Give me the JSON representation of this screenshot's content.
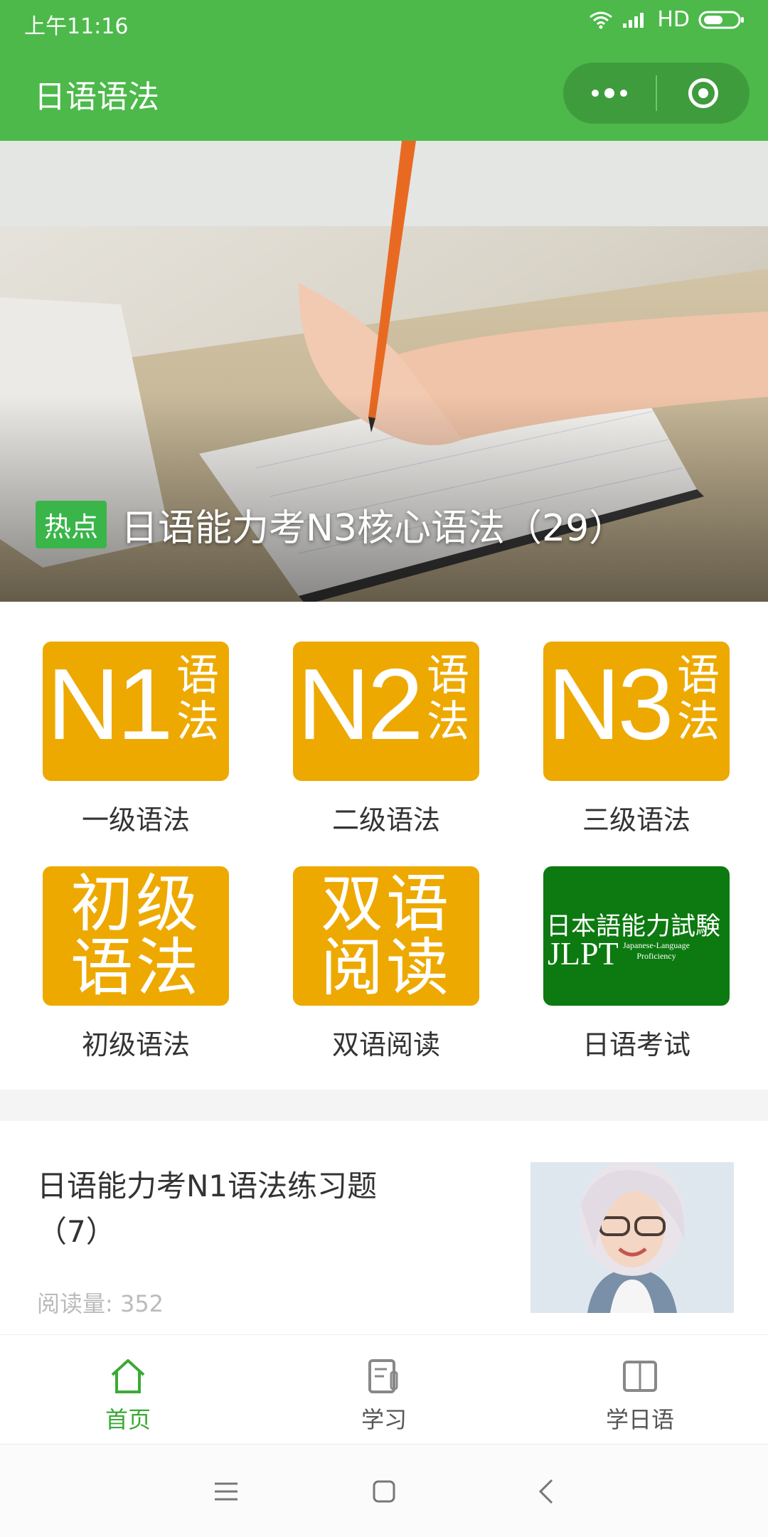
{
  "status": {
    "time": "上午11:16",
    "network": "HD"
  },
  "header": {
    "title": "日语语法",
    "more_icon": "more-dots-icon",
    "close_icon": "target-icon"
  },
  "banner": {
    "badge": "热点",
    "title": "日语能力考N3核心语法（29）"
  },
  "tiles": [
    {
      "big": "N1",
      "small1": "语",
      "small2": "法",
      "label": "一级语法"
    },
    {
      "big": "N2",
      "small1": "语",
      "small2": "法",
      "label": "二级语法"
    },
    {
      "big": "N3",
      "small1": "语",
      "small2": "法",
      "label": "三级语法"
    },
    {
      "line1": "初级",
      "line2": "语法",
      "label": "初级语法"
    },
    {
      "line1": "双语",
      "line2": "阅读",
      "label": "双语阅读"
    },
    {
      "line1": "日本語能力試験",
      "big": "JLPT",
      "small1": "Japanese-Language",
      "small2": "Proficiency",
      "label": "日语考试"
    }
  ],
  "article": {
    "title": "日语能力考N1语法练习题（7）",
    "views": "阅读量: 352"
  },
  "tabs": [
    {
      "label": "首页",
      "icon": "home-icon",
      "active": true
    },
    {
      "label": "学习",
      "icon": "notes-icon",
      "active": false
    },
    {
      "label": "学日语",
      "icon": "book-icon",
      "active": false
    }
  ],
  "colors": {
    "green": "#4cb94a",
    "tile_orange": "#eda900",
    "jlpt_green": "#0c7a10"
  }
}
